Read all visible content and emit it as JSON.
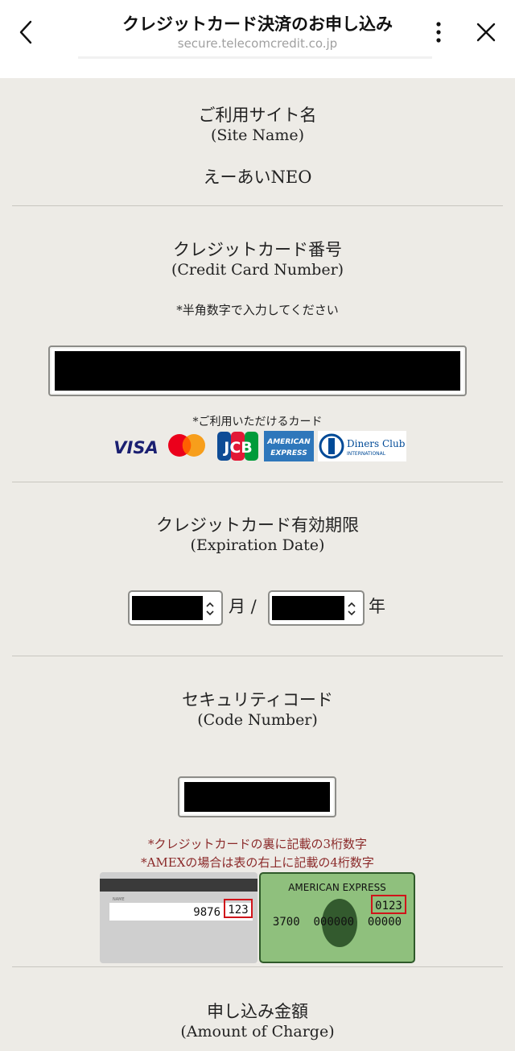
{
  "header": {
    "title": "クレジットカード決済のお申し込み",
    "url": "secure.telecomcredit.co.jp"
  },
  "site": {
    "label_ja": "ご利用サイト名",
    "label_en": "(Site Name)",
    "value": "えーあいNEO"
  },
  "card_number": {
    "label_ja": "クレジットカード番号",
    "label_en": "(Credit Card Number)",
    "hint": "*半角数字で入力してください",
    "accepted_label": "*ご利用いただけるカード",
    "brands": [
      "VISA",
      "Mastercard",
      "JCB",
      "AMERICAN EXPRESS",
      "Diners Club INTERNATIONAL"
    ]
  },
  "expiry": {
    "label_ja": "クレジットカード有効期限",
    "label_en": "(Expiration Date)",
    "month_unit": "月 /",
    "year_unit": "年"
  },
  "security": {
    "label_ja": "セキュリティコード",
    "label_en": "(Code Number)",
    "note1": "*クレジットカードの裏に記載の3桁数字",
    "note2": "*AMEXの場合は表の右上に記載の4桁数字",
    "back_card": {
      "name_label": "NAME",
      "number": "9876",
      "code": "123"
    },
    "amex_card": {
      "brand": "AMERICAN EXPRESS",
      "code": "0123",
      "number": "3700  000000  00000"
    }
  },
  "amount": {
    "label_ja": "申し込み金額",
    "label_en": "(Amount of Charge)"
  },
  "colors": {
    "background": "#edebe6",
    "accent_red": "#8b2a2a",
    "amex_green": "#8fc07d"
  }
}
